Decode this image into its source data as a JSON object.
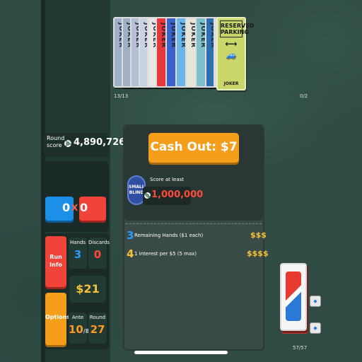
{
  "jokers": {
    "cards": [
      {
        "label": "JOKER",
        "color": "#9fb0c8"
      },
      {
        "label": "JOKER",
        "color": "#9fb0c8"
      },
      {
        "label": "JOKER",
        "color": "#b4c0d6"
      },
      {
        "label": "JOKER",
        "color": "#c9d2e2"
      },
      {
        "label": "JOKER",
        "color": "#e8e4e6"
      },
      {
        "label": "JOKER",
        "color": "#e6383a"
      },
      {
        "label": "JOKER",
        "color": "#3a62c8"
      },
      {
        "label": "JOKER",
        "color": "#6bb6e6"
      },
      {
        "label": "JOKER",
        "color": "#e6e6d8"
      },
      {
        "label": "JOKER",
        "color": "#7ec0c8"
      },
      {
        "label": "JOKER",
        "color": "#2d6fb0"
      },
      {
        "label": "JOKER",
        "color": "#d8dde0"
      }
    ],
    "reserved_parking": {
      "title": "RESERVED PARKING",
      "footer": "JOKER"
    },
    "count": "13/13"
  },
  "consumables": {
    "count": "0/2"
  },
  "round_score": {
    "label_line1": "Round",
    "label_line2": "score",
    "value": "4,890,726"
  },
  "hand": {
    "chips": "0",
    "x": "X",
    "mult": "0"
  },
  "buttons": {
    "run_info_line1": "Run",
    "run_info_line2": "Info",
    "options": "Options"
  },
  "stats": {
    "hands_label": "Hands",
    "hands_value": "3",
    "discards_label": "Discards",
    "discards_value": "0",
    "money": "$21",
    "ante_label": "Ante",
    "ante_value": "10",
    "ante_max": "8",
    "round_label": "Round",
    "round_value": "27"
  },
  "cash_out": {
    "button": "Cash Out: $7",
    "blind_line1": "SMALL",
    "blind_line2": "BLIND",
    "score_at_least": "Score at least",
    "target": "1,000,000",
    "rows": [
      {
        "num": "3",
        "text": "Remaining Hands ($1 each)",
        "dollars": "$$$"
      },
      {
        "num": "4",
        "text": "1 interest per $5 (5 max)",
        "dollars": "$$$$"
      }
    ]
  },
  "deck": {
    "count": "57/57"
  },
  "colors": {
    "chips": "#1c8fe6",
    "mult": "#f0443a",
    "cash_out": "#f59e1c",
    "money": "#f7c237"
  }
}
